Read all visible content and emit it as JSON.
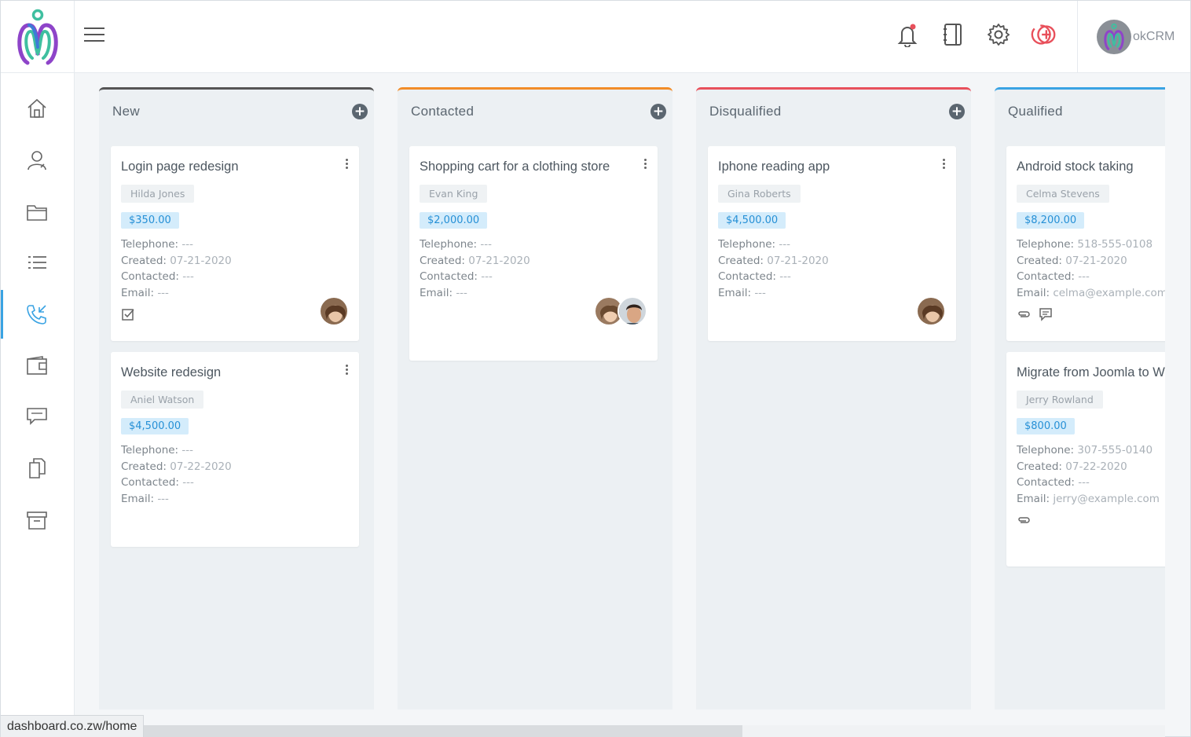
{
  "app": {
    "user_name": "okCRM"
  },
  "status_url": "dashboard.co.zw/home",
  "colors": {
    "accent": "#3aa3e3",
    "new": "#555555",
    "contacted": "#f28c28",
    "disqualified": "#e8505b",
    "qualified": "#3aa3e3",
    "amount_bg": "#d4ecfb",
    "amount_text": "#2690d6"
  },
  "sidebar": {
    "items": [
      {
        "icon": "home-icon"
      },
      {
        "icon": "contacts-icon"
      },
      {
        "icon": "folder-icon"
      },
      {
        "icon": "list-icon"
      },
      {
        "icon": "phone-incoming-icon",
        "active": true
      },
      {
        "icon": "wallet-icon"
      },
      {
        "icon": "chat-icon"
      },
      {
        "icon": "documents-icon"
      },
      {
        "icon": "archive-icon"
      }
    ]
  },
  "labels": {
    "telephone": "Telephone:",
    "created": "Created:",
    "contacted": "Contacted:",
    "email": "Email:"
  },
  "columns": [
    {
      "title": "New",
      "cards": [
        {
          "title": "Login page redesign",
          "person": "Hilda Jones",
          "amount": "$350.00",
          "telephone": "---",
          "created": "07-21-2020",
          "contacted": "---",
          "email": "---"
        },
        {
          "title": "Website redesign",
          "person": "Aniel Watson",
          "amount": "$4,500.00",
          "telephone": "---",
          "created": "07-22-2020",
          "contacted": "---",
          "email": "---"
        }
      ]
    },
    {
      "title": "Contacted",
      "cards": [
        {
          "title": "Shopping cart for a clothing store",
          "person": "Evan King",
          "amount": "$2,000.00",
          "telephone": "---",
          "created": "07-21-2020",
          "contacted": "---",
          "email": "---"
        }
      ]
    },
    {
      "title": "Disqualified",
      "cards": [
        {
          "title": "Iphone reading app",
          "person": "Gina Roberts",
          "amount": "$4,500.00",
          "telephone": "---",
          "created": "07-21-2020",
          "contacted": "---",
          "email": "---"
        }
      ]
    },
    {
      "title": "Qualified",
      "cards": [
        {
          "title": "Android stock taking",
          "person": "Celma Stevens",
          "amount": "$8,200.00",
          "telephone": "518-555-0108",
          "created": "07-21-2020",
          "contacted": "---",
          "email": "celma@example.com"
        },
        {
          "title": "Migrate from Joomla to WordPress",
          "person": "Jerry Rowland",
          "amount": "$800.00",
          "telephone": "307-555-0140",
          "created": "07-22-2020",
          "contacted": "---",
          "email": "jerry@example.com"
        }
      ]
    }
  ]
}
